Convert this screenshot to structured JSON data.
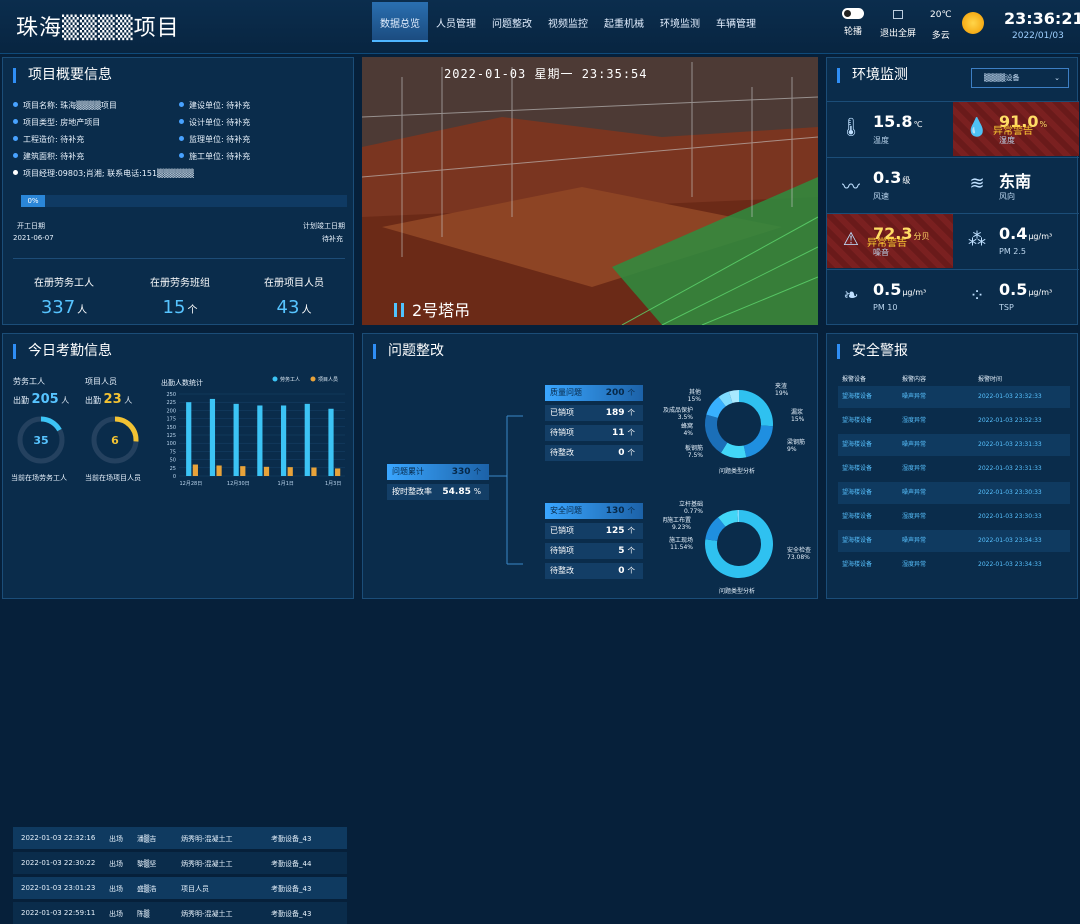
{
  "header": {
    "title": "珠海▒▒▒▒项目",
    "nav": [
      "数据总览",
      "人员管理",
      "问题整改",
      "视频监控",
      "起重机械",
      "环境监测",
      "车辆管理"
    ],
    "broadcast_label": "轮播",
    "fullscreen_label": "退出全屏",
    "temperature": "20℃",
    "weather": "多云",
    "time": "23:36:21",
    "date": "2022/01/03"
  },
  "overview": {
    "title": "项目概要信息",
    "left": [
      {
        "k": "项目名称:",
        "v": "珠海▒▒▒▒项目"
      },
      {
        "k": "项目类型:",
        "v": "房地产项目"
      },
      {
        "k": "工程造价:",
        "v": "待补充"
      },
      {
        "k": "建筑面积:",
        "v": "待补充"
      }
    ],
    "right": [
      {
        "k": "建设单位:",
        "v": "待补充"
      },
      {
        "k": "设计单位:",
        "v": "待补充"
      },
      {
        "k": "监理单位:",
        "v": "待补充"
      },
      {
        "k": "施工单位:",
        "v": "待补充"
      }
    ],
    "manager_label": "项目经理:",
    "manager_value": "09803;肖湘; 联系电话:151▒▒▒▒▒▒",
    "progress_percent": 0,
    "progress_text": "0%",
    "start_label": "开工日期",
    "start_date": "2021-06-07",
    "end_label": "计划竣工日期",
    "end_date": "待补充",
    "stats": [
      {
        "label": "在册劳务工人",
        "value": "337",
        "unit": "人"
      },
      {
        "label": "在册劳务班组",
        "value": "15",
        "unit": "个"
      },
      {
        "label": "在册项目人员",
        "value": "43",
        "unit": "人"
      }
    ]
  },
  "video": {
    "timestamp": "2022-01-03 星期一 23:35:54",
    "camera": "2号塔吊",
    "pause_icon": "pause-icon"
  },
  "env": {
    "title": "环境监测",
    "device_select": "▒▒▒▒设备",
    "cells": [
      {
        "icon": "thermometer-icon",
        "value": "15.8",
        "unit": "℃",
        "label": "温度",
        "alarm": false
      },
      {
        "icon": "humidity-icon",
        "value": "91.0",
        "unit": "%",
        "label": "湿度",
        "alarm": true,
        "alarm_text": "异常警告"
      },
      {
        "icon": "wind-speed-icon",
        "value": "0.3",
        "unit": "级",
        "label": "风速",
        "alarm": false
      },
      {
        "icon": "wind-direction-icon",
        "value": "东南",
        "unit": "",
        "label": "风向",
        "alarm": false
      },
      {
        "icon": "noise-icon",
        "value": "72.3",
        "unit": "分贝",
        "label": "噪音",
        "alarm": true,
        "alarm_text": "异常警告"
      },
      {
        "icon": "pm25-icon",
        "value": "0.4",
        "unit": "μg/m³",
        "label": "PM 2.5",
        "alarm": false
      },
      {
        "icon": "pm10-icon",
        "value": "0.5",
        "unit": "μg/m³",
        "label": "PM 10",
        "alarm": false
      },
      {
        "icon": "tsp-icon",
        "value": "0.5",
        "unit": "μg/m³",
        "label": "TSP",
        "alarm": false
      }
    ]
  },
  "attendance": {
    "title": "今日考勤信息",
    "labor_label": "劳务工人",
    "labor_present_label": "出勤",
    "labor_present": "205",
    "labor_unit": "人",
    "labor_on_site": "35",
    "labor_on_site_caption": "当前在场劳务工人",
    "staff_label": "项目人员",
    "staff_present_label": "出勤",
    "staff_present": "23",
    "staff_unit": "人",
    "staff_on_site": "6",
    "staff_on_site_caption": "当前在场项目人员",
    "chart_title": "出勤人数统计",
    "records": [
      {
        "time": "2022-01-03 22:32:16",
        "dir": "出场",
        "name": "潘▒吉",
        "team": "炳秀明-混凝土工",
        "device": "考勤设备_43"
      },
      {
        "time": "2022-01-03 22:30:22",
        "dir": "出场",
        "name": "黎▒坚",
        "team": "炳秀明-混凝土工",
        "device": "考勤设备_44"
      },
      {
        "time": "2022-01-03 23:01:23",
        "dir": "出场",
        "name": "盛▒浩",
        "team": "项目人员",
        "device": "考勤设备_43"
      },
      {
        "time": "2022-01-03 22:59:11",
        "dir": "出场",
        "name": "陈▒",
        "team": "炳秀明-混凝土工",
        "device": "考勤设备_43"
      }
    ]
  },
  "chart_data": {
    "type": "bar",
    "title": "出勤人数统计",
    "categories": [
      "12月28日",
      "",
      "12月30日",
      "",
      "1月1日",
      "",
      "1月3日"
    ],
    "series": [
      {
        "name": "劳务工人",
        "values": [
          225,
          235,
          220,
          215,
          215,
          220,
          205
        ],
        "color": "#3cc4f5"
      },
      {
        "name": "项目人员",
        "values": [
          35,
          32,
          30,
          28,
          27,
          26,
          23
        ],
        "color": "#e8a33a"
      }
    ],
    "ylim": [
      0,
      250
    ],
    "yticks": [
      0,
      25,
      50,
      75,
      100,
      125,
      150,
      175,
      200,
      225,
      250
    ],
    "legend": "top-right"
  },
  "issues": {
    "title": "问题整改",
    "total_label": "问题累计",
    "total_value": "330",
    "total_unit": "个",
    "rate_label": "按时整改率",
    "rate_value": "54.85",
    "rate_unit": "%",
    "quality": [
      {
        "label": "质量问题",
        "value": "200",
        "unit": "个"
      },
      {
        "label": "已销项",
        "value": "189",
        "unit": "个"
      },
      {
        "label": "待销项",
        "value": "11",
        "unit": "个"
      },
      {
        "label": "待整改",
        "value": "0",
        "unit": "个"
      }
    ],
    "safety": [
      {
        "label": "安全问题",
        "value": "130",
        "unit": "个"
      },
      {
        "label": "已销项",
        "value": "125",
        "unit": "个"
      },
      {
        "label": "待销项",
        "value": "5",
        "unit": "个"
      },
      {
        "label": "待整改",
        "value": "0",
        "unit": "个"
      }
    ],
    "quality_donut_title": "问题类型分析",
    "quality_donut": [
      {
        "name": "夹渣",
        "pct": "19%",
        "value": 19
      },
      {
        "name": "漏浆",
        "pct": "15%",
        "value": 15
      },
      {
        "name": "梁钢筋",
        "pct": "9%",
        "value": 9
      },
      {
        "name": "其他",
        "pct": "15%",
        "value": 15
      },
      {
        "name": "板钢筋",
        "pct": "7.5%",
        "value": 7.5
      },
      {
        "name": "蜂窝",
        "pct": "4%",
        "value": 4
      },
      {
        "name": "漏及成品保护",
        "pct": "3.5%",
        "value": 3.5
      }
    ],
    "safety_donut_title": "问题类型分析",
    "safety_donut": [
      {
        "name": "安全检查",
        "pct": "73.08%",
        "value": 73.08
      },
      {
        "name": "施工现场",
        "pct": "11.54%",
        "value": 11.54
      },
      {
        "name": "文明施工布置",
        "pct": "9.23%",
        "value": 9.23
      },
      {
        "name": "立杆基础",
        "pct": "0.77%",
        "value": 0.77
      }
    ]
  },
  "safety_alarm": {
    "title": "安全警报",
    "headers": [
      "报警设备",
      "报警内容",
      "报警时间"
    ],
    "rows": [
      [
        "望海楼设备",
        "噪声异常",
        "2022-01-03 23:32:33"
      ],
      [
        "望海楼设备",
        "湿度异常",
        "2022-01-03 23:32:33"
      ],
      [
        "望海楼设备",
        "噪声异常",
        "2022-01-03 23:31:33"
      ],
      [
        "望海楼设备",
        "湿度异常",
        "2022-01-03 23:31:33"
      ],
      [
        "望海楼设备",
        "噪声异常",
        "2022-01-03 23:30:33"
      ],
      [
        "望海楼设备",
        "湿度异常",
        "2022-01-03 23:30:33"
      ],
      [
        "望海楼设备",
        "噪声异常",
        "2022-01-03 23:34:33"
      ],
      [
        "望海楼设备",
        "湿度异常",
        "2022-01-03 23:34:33"
      ]
    ]
  }
}
